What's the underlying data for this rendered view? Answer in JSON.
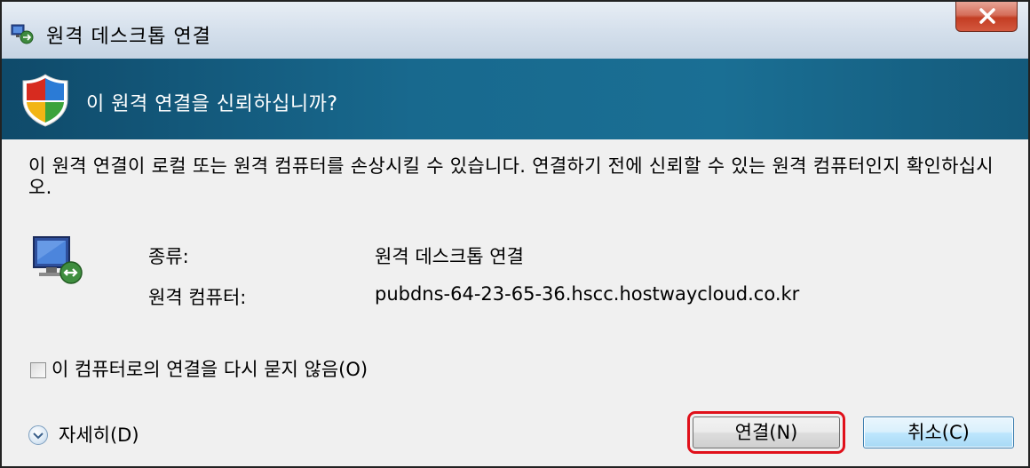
{
  "window": {
    "title": "원격 데스크톱 연결",
    "close_label": "X"
  },
  "header": {
    "question": "이 원격 연결을 신뢰하십니까?",
    "icon": "shield-icon"
  },
  "body": {
    "warning": "이 원격 연결이 로컬 또는 원격 컴퓨터를 손상시킬 수 있습니다. 연결하기 전에 신뢰할 수 있는 원격 컴퓨터인지 확인하십시오.",
    "fields": [
      {
        "label": "종류:",
        "value": "원격 데스크톱 연결"
      },
      {
        "label": "원격 컴퓨터:",
        "value": "pubdns-64-23-65-36.hscc.hostwaycloud.co.kr"
      }
    ],
    "dont_ask_checkbox": {
      "label": "이 컴퓨터로의 연결을 다시 묻지 않음(O)",
      "checked": false
    },
    "details_label": "자세히(D)"
  },
  "buttons": {
    "connect": "연결(N)",
    "cancel": "취소(C)"
  },
  "colors": {
    "header_bg": "#18698e",
    "highlight": "#e0101a",
    "close_red": "#c33d23"
  }
}
